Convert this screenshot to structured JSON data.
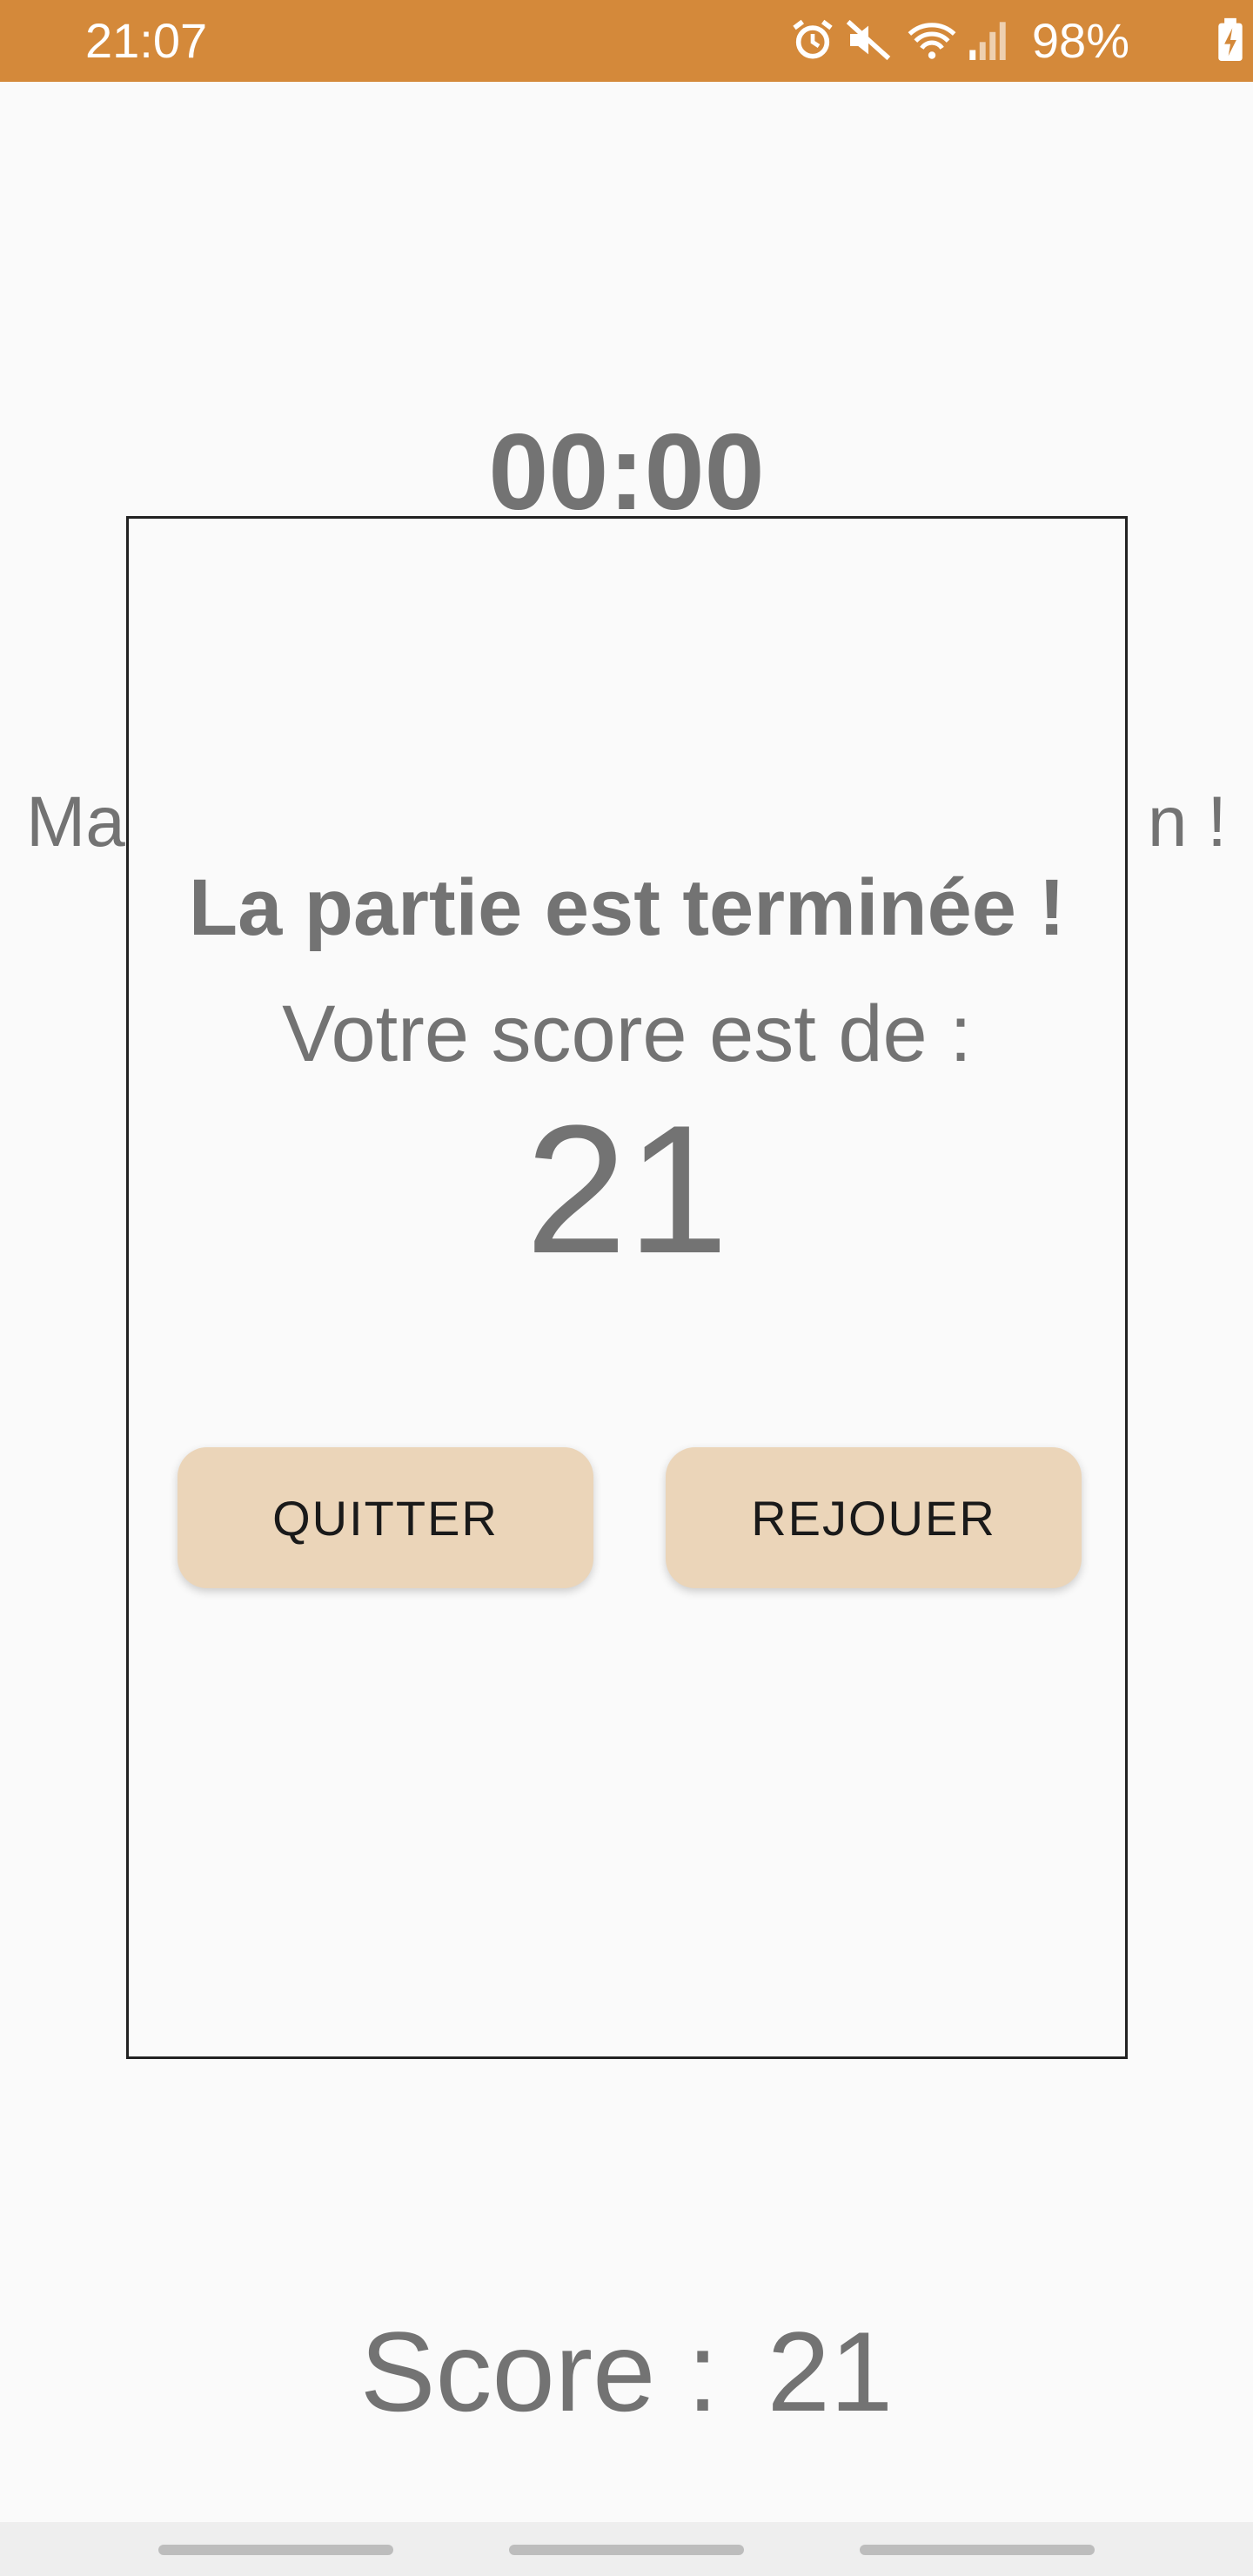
{
  "status_bar": {
    "time": "21:07",
    "battery": "98%",
    "icons": [
      "alarm-icon",
      "mute-icon",
      "wifi-icon",
      "signal-icon",
      "battery-charging-icon"
    ],
    "background_color": "#d4893a"
  },
  "game": {
    "timer": "00:00",
    "instruction_visible_left": "Ma",
    "instruction_visible_right": "n !",
    "score_label": "Score :",
    "score_value": "21"
  },
  "dialog": {
    "title": "La partie est terminée !",
    "subtitle": "Votre score est de :",
    "score": "21",
    "quit_label": "QUITTER",
    "replay_label": "REJOUER",
    "button_color": "#ebd5b9"
  },
  "nav_bar": {
    "items": [
      "nav-left",
      "nav-center",
      "nav-right"
    ]
  }
}
